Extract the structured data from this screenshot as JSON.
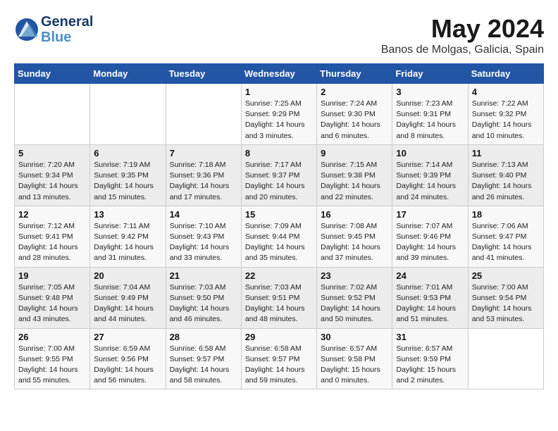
{
  "header": {
    "logo_line1": "General",
    "logo_line2": "Blue",
    "main_title": "May 2024",
    "subtitle": "Banos de Molgas, Galicia, Spain"
  },
  "days_of_week": [
    "Sunday",
    "Monday",
    "Tuesday",
    "Wednesday",
    "Thursday",
    "Friday",
    "Saturday"
  ],
  "weeks": [
    [
      {
        "day": "",
        "info": ""
      },
      {
        "day": "",
        "info": ""
      },
      {
        "day": "",
        "info": ""
      },
      {
        "day": "1",
        "info": "Sunrise: 7:25 AM\nSunset: 9:29 PM\nDaylight: 14 hours\nand 3 minutes."
      },
      {
        "day": "2",
        "info": "Sunrise: 7:24 AM\nSunset: 9:30 PM\nDaylight: 14 hours\nand 6 minutes."
      },
      {
        "day": "3",
        "info": "Sunrise: 7:23 AM\nSunset: 9:31 PM\nDaylight: 14 hours\nand 8 minutes."
      },
      {
        "day": "4",
        "info": "Sunrise: 7:22 AM\nSunset: 9:32 PM\nDaylight: 14 hours\nand 10 minutes."
      }
    ],
    [
      {
        "day": "5",
        "info": "Sunrise: 7:20 AM\nSunset: 9:34 PM\nDaylight: 14 hours\nand 13 minutes."
      },
      {
        "day": "6",
        "info": "Sunrise: 7:19 AM\nSunset: 9:35 PM\nDaylight: 14 hours\nand 15 minutes."
      },
      {
        "day": "7",
        "info": "Sunrise: 7:18 AM\nSunset: 9:36 PM\nDaylight: 14 hours\nand 17 minutes."
      },
      {
        "day": "8",
        "info": "Sunrise: 7:17 AM\nSunset: 9:37 PM\nDaylight: 14 hours\nand 20 minutes."
      },
      {
        "day": "9",
        "info": "Sunrise: 7:15 AM\nSunset: 9:38 PM\nDaylight: 14 hours\nand 22 minutes."
      },
      {
        "day": "10",
        "info": "Sunrise: 7:14 AM\nSunset: 9:39 PM\nDaylight: 14 hours\nand 24 minutes."
      },
      {
        "day": "11",
        "info": "Sunrise: 7:13 AM\nSunset: 9:40 PM\nDaylight: 14 hours\nand 26 minutes."
      }
    ],
    [
      {
        "day": "12",
        "info": "Sunrise: 7:12 AM\nSunset: 9:41 PM\nDaylight: 14 hours\nand 28 minutes."
      },
      {
        "day": "13",
        "info": "Sunrise: 7:11 AM\nSunset: 9:42 PM\nDaylight: 14 hours\nand 31 minutes."
      },
      {
        "day": "14",
        "info": "Sunrise: 7:10 AM\nSunset: 9:43 PM\nDaylight: 14 hours\nand 33 minutes."
      },
      {
        "day": "15",
        "info": "Sunrise: 7:09 AM\nSunset: 9:44 PM\nDaylight: 14 hours\nand 35 minutes."
      },
      {
        "day": "16",
        "info": "Sunrise: 7:08 AM\nSunset: 9:45 PM\nDaylight: 14 hours\nand 37 minutes."
      },
      {
        "day": "17",
        "info": "Sunrise: 7:07 AM\nSunset: 9:46 PM\nDaylight: 14 hours\nand 39 minutes."
      },
      {
        "day": "18",
        "info": "Sunrise: 7:06 AM\nSunset: 9:47 PM\nDaylight: 14 hours\nand 41 minutes."
      }
    ],
    [
      {
        "day": "19",
        "info": "Sunrise: 7:05 AM\nSunset: 9:48 PM\nDaylight: 14 hours\nand 43 minutes."
      },
      {
        "day": "20",
        "info": "Sunrise: 7:04 AM\nSunset: 9:49 PM\nDaylight: 14 hours\nand 44 minutes."
      },
      {
        "day": "21",
        "info": "Sunrise: 7:03 AM\nSunset: 9:50 PM\nDaylight: 14 hours\nand 46 minutes."
      },
      {
        "day": "22",
        "info": "Sunrise: 7:03 AM\nSunset: 9:51 PM\nDaylight: 14 hours\nand 48 minutes."
      },
      {
        "day": "23",
        "info": "Sunrise: 7:02 AM\nSunset: 9:52 PM\nDaylight: 14 hours\nand 50 minutes."
      },
      {
        "day": "24",
        "info": "Sunrise: 7:01 AM\nSunset: 9:53 PM\nDaylight: 14 hours\nand 51 minutes."
      },
      {
        "day": "25",
        "info": "Sunrise: 7:00 AM\nSunset: 9:54 PM\nDaylight: 14 hours\nand 53 minutes."
      }
    ],
    [
      {
        "day": "26",
        "info": "Sunrise: 7:00 AM\nSunset: 9:55 PM\nDaylight: 14 hours\nand 55 minutes."
      },
      {
        "day": "27",
        "info": "Sunrise: 6:59 AM\nSunset: 9:56 PM\nDaylight: 14 hours\nand 56 minutes."
      },
      {
        "day": "28",
        "info": "Sunrise: 6:58 AM\nSunset: 9:57 PM\nDaylight: 14 hours\nand 58 minutes."
      },
      {
        "day": "29",
        "info": "Sunrise: 6:58 AM\nSunset: 9:57 PM\nDaylight: 14 hours\nand 59 minutes."
      },
      {
        "day": "30",
        "info": "Sunrise: 6:57 AM\nSunset: 9:58 PM\nDaylight: 15 hours\nand 0 minutes."
      },
      {
        "day": "31",
        "info": "Sunrise: 6:57 AM\nSunset: 9:59 PM\nDaylight: 15 hours\nand 2 minutes."
      },
      {
        "day": "",
        "info": ""
      }
    ]
  ]
}
